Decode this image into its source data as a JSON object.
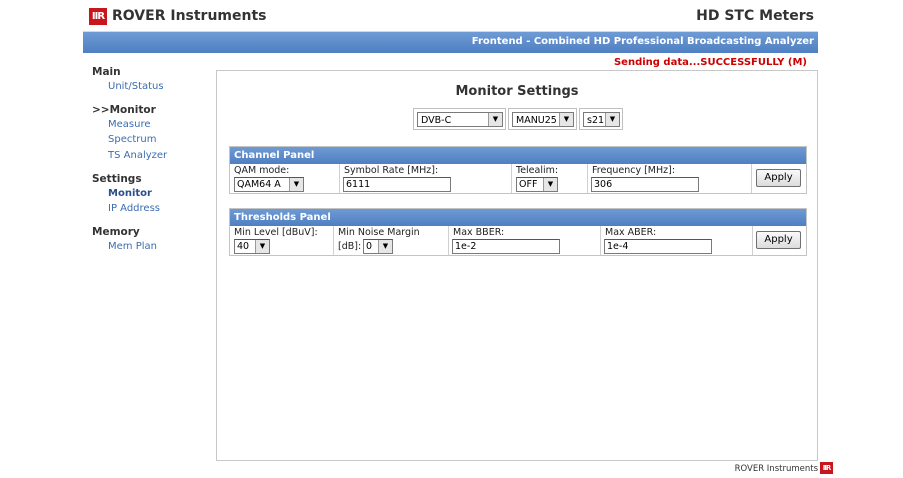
{
  "header": {
    "logo_text": "IIR",
    "brand": "ROVER Instruments",
    "product": "HD STC Meters",
    "subtitle": "Frontend - Combined HD Professional Broadcasting Analyzer",
    "status": "Sending data...SUCCESSFULLY (M)"
  },
  "sidebar": {
    "sections": [
      {
        "label": "Main",
        "items": [
          {
            "label": "Unit/Status"
          }
        ]
      },
      {
        "label": ">>Monitor",
        "items": [
          {
            "label": "Measure"
          },
          {
            "label": "Spectrum"
          },
          {
            "label": "TS Analyzer"
          }
        ]
      },
      {
        "label": "Settings",
        "items": [
          {
            "label": "Monitor"
          },
          {
            "label": "IP Address"
          }
        ]
      },
      {
        "label": "Memory",
        "items": [
          {
            "label": "Mem Plan"
          }
        ]
      }
    ]
  },
  "main": {
    "title": "Monitor Settings",
    "selects": {
      "standard": "DVB-C",
      "memory": "MANU25",
      "slot": "s21"
    },
    "channel_panel": {
      "title": "Channel Panel",
      "qam_label": "QAM mode:",
      "qam_value": "QAM64 A",
      "symbol_label": "Symbol Rate [MHz]:",
      "symbol_value": "6111",
      "telealim_label": "Telealim:",
      "telealim_value": "OFF",
      "freq_label": "Frequency [MHz]:",
      "freq_value": "306",
      "apply_label": "Apply"
    },
    "thresholds_panel": {
      "title": "Thresholds Panel",
      "min_level_label": "Min Level [dBuV]:",
      "min_level_value": "40",
      "noise_label_line1": "Min Noise Margin",
      "noise_label_line2": "[dB]:",
      "noise_value": "0",
      "bber_label": "Max BBER:",
      "bber_value": "1e-2",
      "aber_label": "Max ABER:",
      "aber_value": "1e-4",
      "apply_label": "Apply"
    }
  },
  "footer": {
    "text": "ROVER Instruments",
    "logo_text": "IIR"
  },
  "icons": {
    "dropdown": "chevron-down-icon"
  },
  "colors": {
    "accent_blue": "#5a88c8",
    "status_red": "#cc0000",
    "logo_red": "#c8161d"
  }
}
